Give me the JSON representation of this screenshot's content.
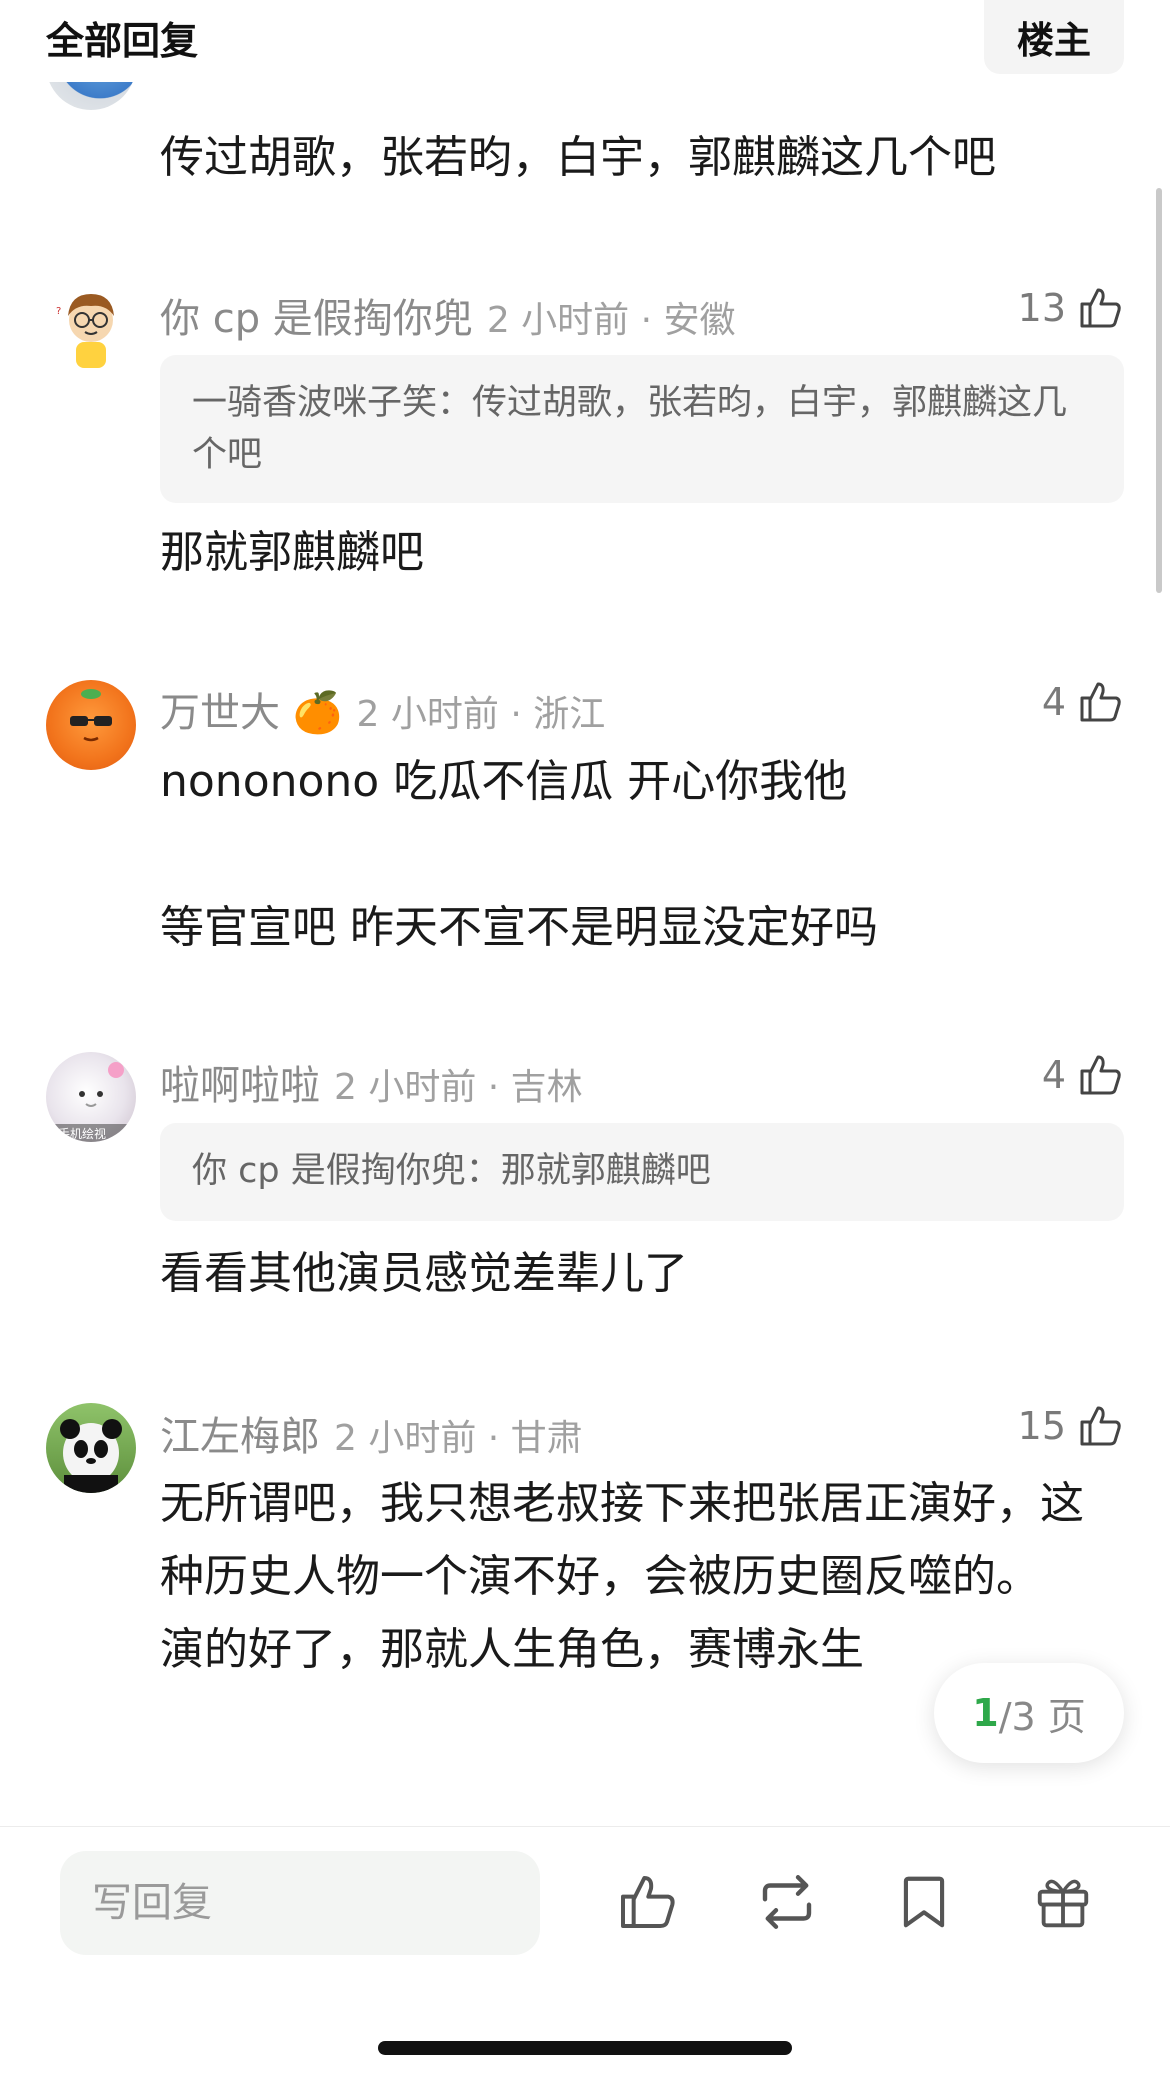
{
  "header": {
    "title": "全部回复",
    "op_button": "楼主"
  },
  "comments": [
    {
      "username": "",
      "time": "",
      "likes": "",
      "quote": null,
      "body": "传过胡歌，张若昀，白宇，郭麒麟这几个吧"
    },
    {
      "username": "你 cp 是假掏你兜",
      "time": "2 小时前 · 安徽",
      "likes": "13",
      "quote": {
        "name": "一骑香波咪子笑：",
        "text": "传过胡歌，张若昀，白宇，郭麒麟这几个吧"
      },
      "body": "那就郭麒麟吧"
    },
    {
      "username": "万世大",
      "emoji": "🍊",
      "time": "2 小时前 · 浙江",
      "likes": "4",
      "quote": null,
      "body": "nononono 吃瓜不信瓜 开心你我他\n\n等官宣吧 昨天不宣不是明显没定好吗"
    },
    {
      "username": "啦啊啦啦",
      "time": "2 小时前 · 吉林",
      "likes": "4",
      "quote": {
        "name": "你 cp 是假掏你兜：",
        "text": "那就郭麒麟吧"
      },
      "body": "看看其他演员感觉差辈儿了"
    },
    {
      "username": "江左梅郎",
      "time": "2 小时前 · 甘肃",
      "likes": "15",
      "quote": null,
      "body": "无所谓吧，我只想老叔接下来把张居正演好，这种历史人物一个演不好，会被历史圈反噬的。\n演的好了，那就人生角色，赛博永生"
    }
  ],
  "avatar_badge": "手机绘视",
  "pager": {
    "current": "1",
    "rest": "/3 页"
  },
  "bottom_bar": {
    "reply_placeholder": "写回复",
    "icons": [
      "thumbs-up-icon",
      "repost-icon",
      "bookmark-icon",
      "gift-icon"
    ]
  },
  "colors": {
    "accent_green": "#2ea84a",
    "meta_gray": "#8a8a8a",
    "quote_bg": "#f5f5f5"
  }
}
